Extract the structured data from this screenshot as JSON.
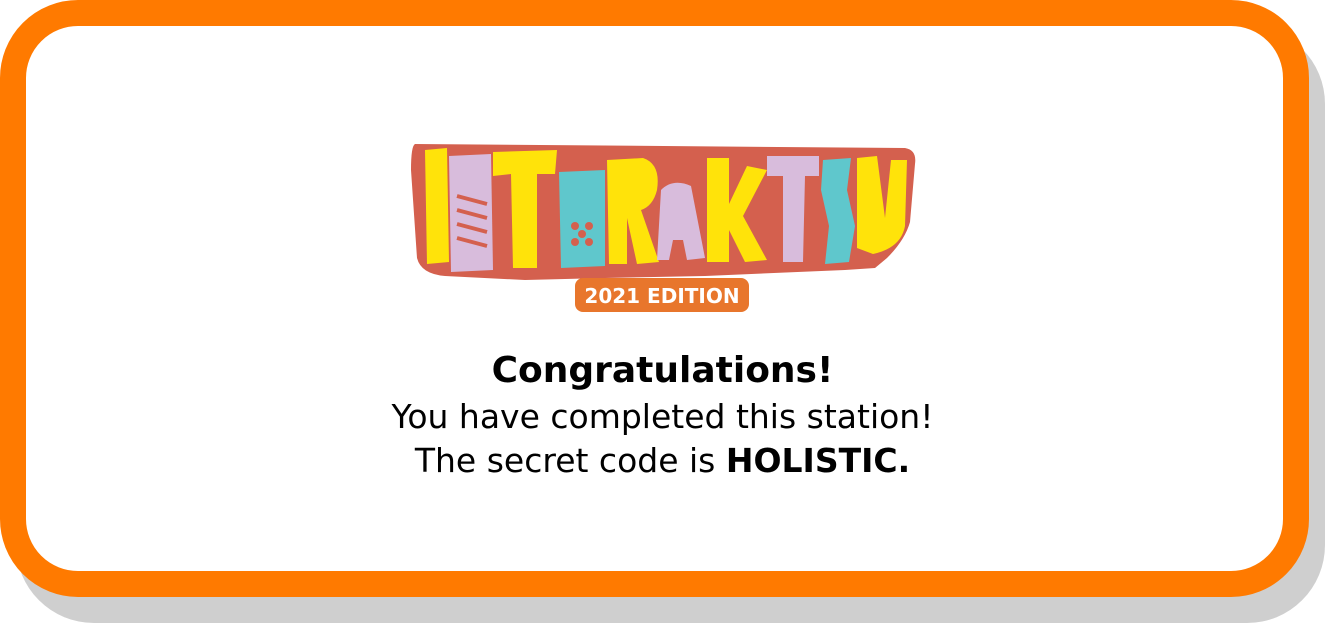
{
  "logo": {
    "wordmark": "INTERAKTIV",
    "edition_badge": "2021 EDITION",
    "colors": {
      "outline": "#d4604e",
      "yellow": "#ffe30a",
      "lilac": "#d8bcdc",
      "teal": "#5fc7cc",
      "badge_orange": "#e8762c"
    }
  },
  "message": {
    "heading": "Congratulations!",
    "line1": "You have completed this station!",
    "line2_prefix": "The secret code is ",
    "secret_code": "HOLISTIC."
  },
  "colors": {
    "frame_border": "#ff7a00",
    "frame_shadow": "#cfcfcf",
    "background": "#ffffff",
    "text": "#000000"
  }
}
